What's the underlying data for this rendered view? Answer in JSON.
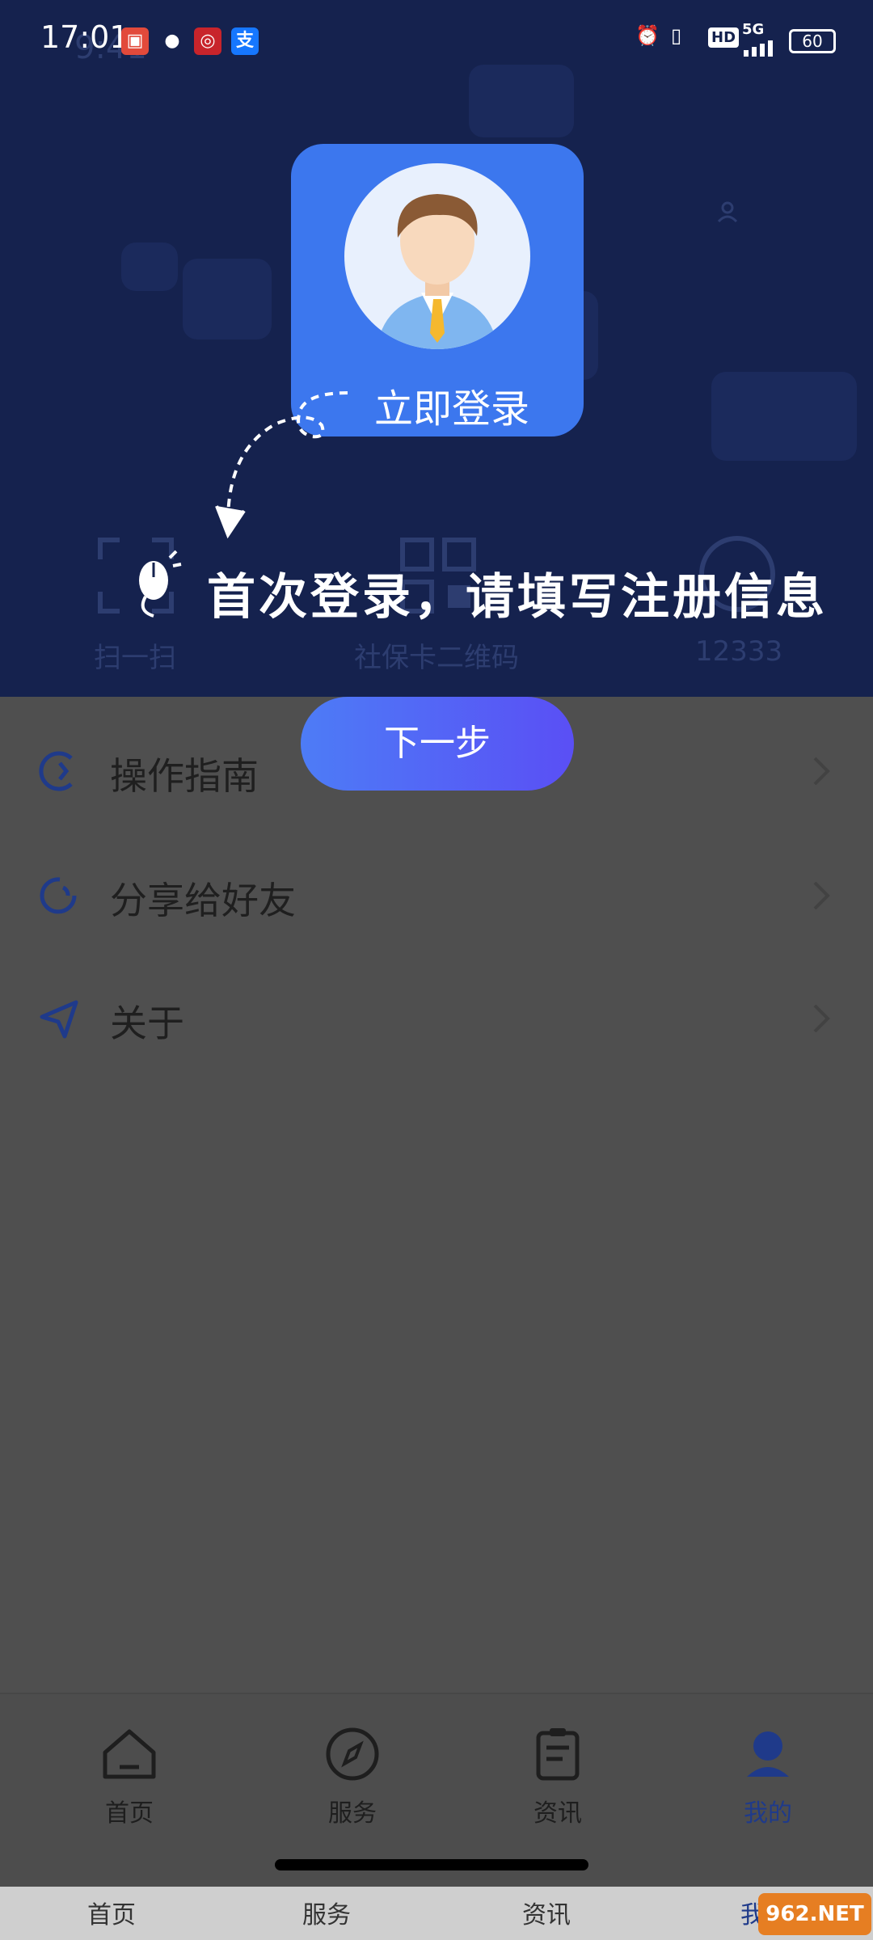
{
  "status_bar": {
    "time": "17:01",
    "battery": "60",
    "network": "5G",
    "hd": "HD"
  },
  "background_shortcuts": [
    {
      "label": "扫一扫"
    },
    {
      "label": "社保卡二维码"
    },
    {
      "label": "12333"
    }
  ],
  "ghost_time": "9:41",
  "login_card": {
    "label": "立即登录"
  },
  "hint_text": "首次登录，请填写注册信息",
  "next_button": {
    "label": "下一步"
  },
  "menu": [
    {
      "label": "操作指南",
      "icon": "guide-icon"
    },
    {
      "label": "分享给好友",
      "icon": "share-icon"
    },
    {
      "label": "关于",
      "icon": "about-icon"
    }
  ],
  "tabs": [
    {
      "label": "首页",
      "icon": "home-icon"
    },
    {
      "label": "服务",
      "icon": "compass-icon"
    },
    {
      "label": "资讯",
      "icon": "news-icon"
    },
    {
      "label": "我的",
      "icon": "profile-icon",
      "active": true
    }
  ],
  "bottom_strip": [
    "首页",
    "服务",
    "资讯",
    "我"
  ],
  "watermark": "962.NET",
  "colors": {
    "overlay": "#15224e",
    "login_card": "#3c77ee",
    "button_start": "#4d7cf6",
    "button_end": "#5a4ff5",
    "active_tab": "#1f3a8a"
  }
}
